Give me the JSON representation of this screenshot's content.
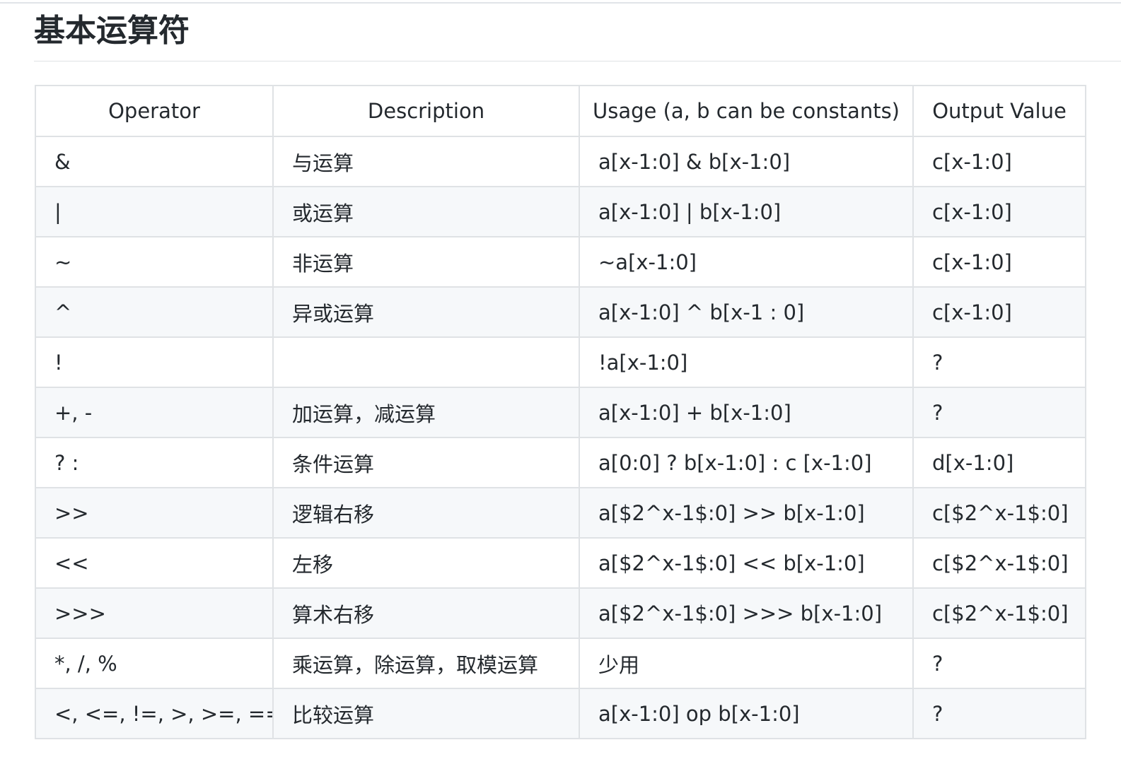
{
  "title": "基本运算符",
  "table": {
    "headers": [
      "Operator",
      "Description",
      "Usage (a, b can be constants)",
      "Output Value"
    ],
    "rows": [
      {
        "operator": "&",
        "description": "与运算",
        "usage": "a[x-1:0] & b[x-1:0]",
        "output": "c[x-1:0]"
      },
      {
        "operator": "|",
        "description": "或运算",
        "usage": "a[x-1:0] | b[x-1:0]",
        "output": "c[x-1:0]"
      },
      {
        "operator": "~",
        "description": "非运算",
        "usage": "~a[x-1:0]",
        "output": "c[x-1:0]"
      },
      {
        "operator": "^",
        "description": "异或运算",
        "usage": "a[x-1:0] ^ b[x-1 : 0]",
        "output": "c[x-1:0]"
      },
      {
        "operator": "!",
        "description": "",
        "usage": "!a[x-1:0]",
        "output": "?"
      },
      {
        "operator": "+, -",
        "description": "加运算，减运算",
        "usage": "a[x-1:0] + b[x-1:0]",
        "output": "?"
      },
      {
        "operator": "? :",
        "description": "条件运算",
        "usage": "a[0:0] ? b[x-1:0] : c [x-1:0]",
        "output": "d[x-1:0]"
      },
      {
        "operator": ">>",
        "description": "逻辑右移",
        "usage": "a[$2^x-1$:0] >> b[x-1:0]",
        "output": "c[$2^x-1$:0]"
      },
      {
        "operator": "<<",
        "description": "左移",
        "usage": "a[$2^x-1$:0] << b[x-1:0]",
        "output": "c[$2^x-1$:0]"
      },
      {
        "operator": ">>>",
        "description": "算术右移",
        "usage": "a[$2^x-1$:0] >>> b[x-1:0]",
        "output": "c[$2^x-1$:0]"
      },
      {
        "operator": "*, /, %",
        "description": "乘运算，除运算，取模运算",
        "usage": "少用",
        "output": "?"
      },
      {
        "operator": "<, <=, !=, >, >=, ==",
        "description": "比较运算",
        "usage": "a[x-1:0] op b[x-1:0]",
        "output": "?"
      }
    ]
  }
}
